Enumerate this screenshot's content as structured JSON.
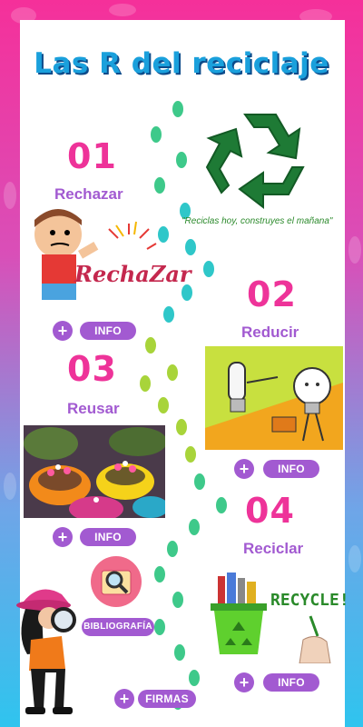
{
  "header": {
    "title": "Las R del reciclaje"
  },
  "slogan": "\"Reciclas hoy, construyes el mañana\"",
  "steps": [
    {
      "number": "01",
      "label": "Rechazar",
      "image_word": "RechaZar",
      "info": "INFO",
      "plus": "+"
    },
    {
      "number": "02",
      "label": "Reducir",
      "info": "INFO",
      "plus": "+"
    },
    {
      "number": "03",
      "label": "Reusar",
      "info": "INFO",
      "plus": "+"
    },
    {
      "number": "04",
      "label": "Reciclar",
      "image_word": "RECYCLE!",
      "info": "INFO",
      "plus": "+"
    }
  ],
  "footer": {
    "bibliography": "BIBLIOGRAFÍA",
    "signatures": "FIRMAS",
    "plus": "+"
  },
  "colors": {
    "accent_pink": "#ee3399",
    "accent_purple": "#a25ad1",
    "title_blue": "#1aa0dc",
    "recycle_green": "#1e7a35"
  },
  "icons": [
    "recycle-icon",
    "footprints-icon",
    "magnifier-icon",
    "detective-girl-icon"
  ]
}
